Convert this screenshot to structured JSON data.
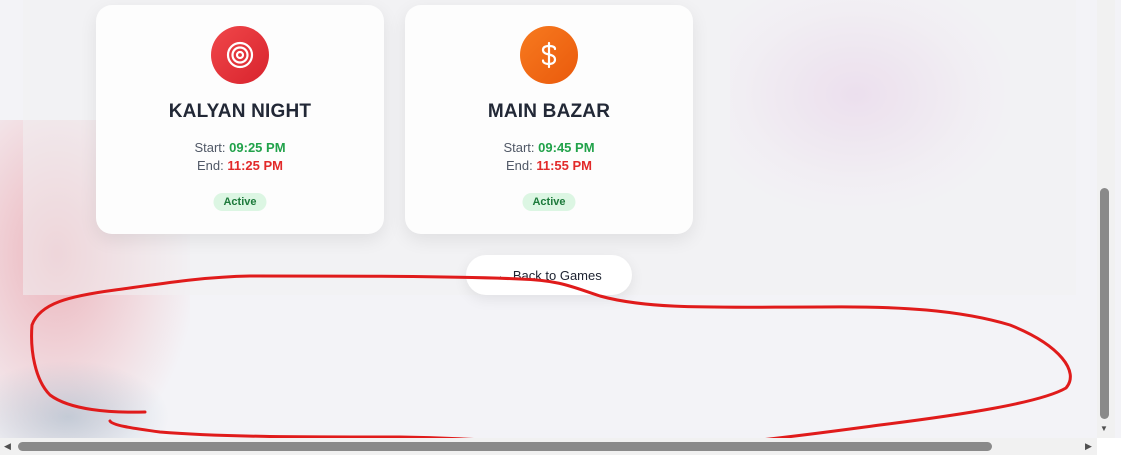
{
  "games": [
    {
      "name": "KALYAN NIGHT",
      "icon": "target-icon",
      "icon_color": "#e53539",
      "start_label": "Start:",
      "start_time": "09:25 PM",
      "end_label": "End:",
      "end_time": "11:25 PM",
      "status": "Active"
    },
    {
      "name": "MAIN BAZAR",
      "icon": "dollar-icon",
      "icon_color": "#f06a14",
      "start_label": "Start:",
      "start_time": "09:45 PM",
      "end_label": "End:",
      "end_time": "11:55 PM",
      "status": "Active"
    }
  ],
  "back_button": {
    "label": "← Back to Games"
  },
  "colors": {
    "start_time": "#21a24a",
    "end_time": "#e22a2a",
    "badge_bg": "#dcf6e3",
    "badge_text": "#1d7a3b",
    "annotation": "#e01b1b"
  }
}
